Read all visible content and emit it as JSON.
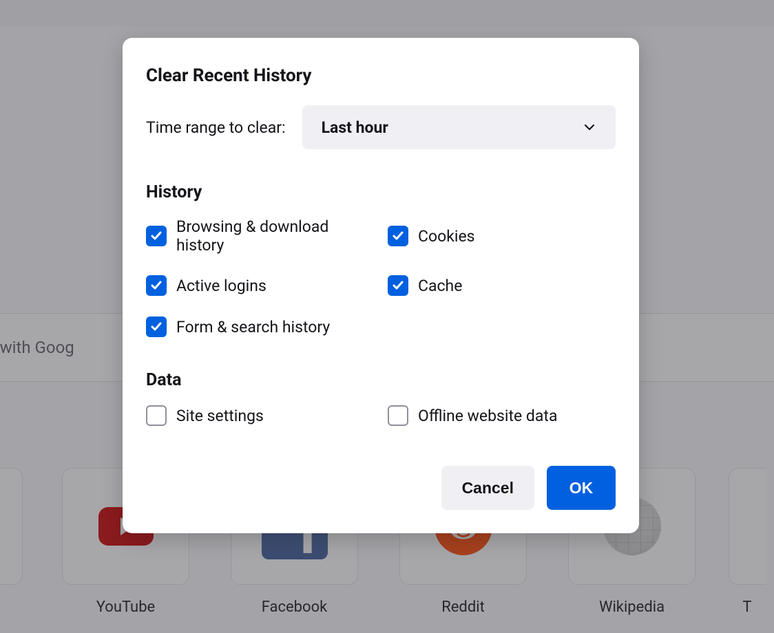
{
  "background": {
    "search_placeholder_fragment": "rch with Goog",
    "tiles": [
      {
        "label": "",
        "icon": "partial"
      },
      {
        "label": "YouTube",
        "icon": "youtube"
      },
      {
        "label": "Facebook",
        "icon": "facebook"
      },
      {
        "label": "Reddit",
        "icon": "reddit"
      },
      {
        "label": "Wikipedia",
        "icon": "wikipedia"
      },
      {
        "label": "T",
        "icon": "partial-right"
      }
    ]
  },
  "dialog": {
    "title": "Clear Recent History",
    "time_range_label": "Time range to clear:",
    "time_range_value": "Last hour",
    "sections": {
      "history": {
        "heading": "History",
        "items": [
          {
            "label": "Browsing & download history",
            "checked": true
          },
          {
            "label": "Cookies",
            "checked": true
          },
          {
            "label": "Active logins",
            "checked": true
          },
          {
            "label": "Cache",
            "checked": true
          },
          {
            "label": "Form & search history",
            "checked": true
          }
        ]
      },
      "data": {
        "heading": "Data",
        "items": [
          {
            "label": "Site settings",
            "checked": false
          },
          {
            "label": "Offline website data",
            "checked": false
          }
        ]
      }
    },
    "buttons": {
      "cancel": "Cancel",
      "ok": "OK"
    }
  }
}
